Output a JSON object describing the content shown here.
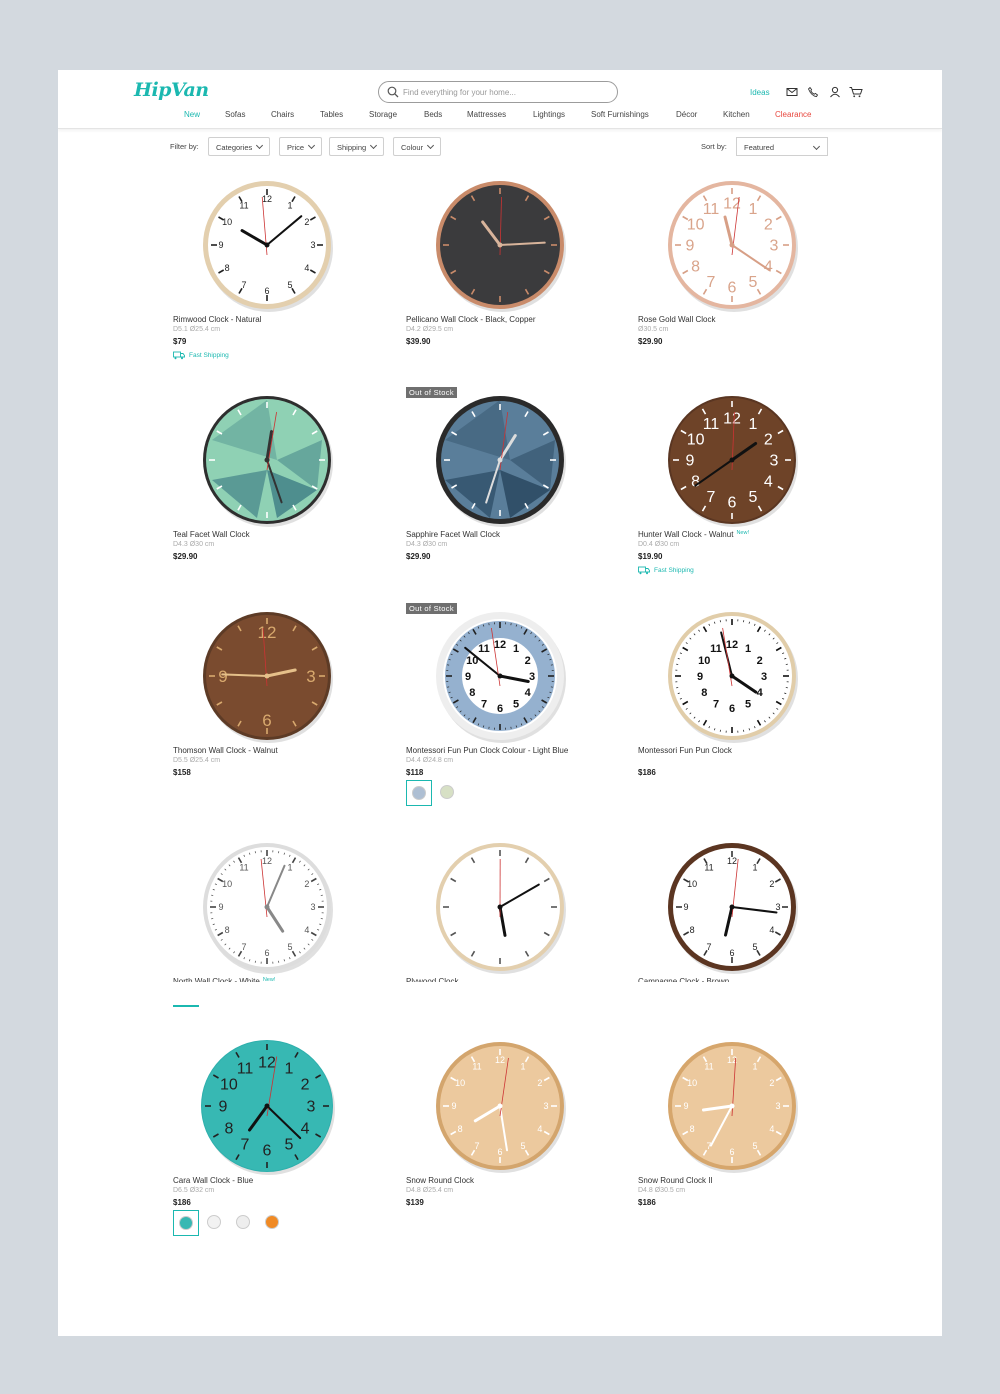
{
  "header": {
    "logo": "HipVan",
    "search_placeholder": "Find everything for your home...",
    "ideas_label": "Ideas",
    "icons": [
      "mail-icon",
      "phone-icon",
      "user-icon",
      "cart-icon"
    ]
  },
  "nav": [
    "New",
    "Sofas",
    "Chairs",
    "Tables",
    "Storage",
    "Beds",
    "Mattresses",
    "Lightings",
    "Soft Furnishings",
    "Décor",
    "Kitchen",
    "Clearance"
  ],
  "colors": {
    "accent": "#1bb8b0",
    "clearance": "#e8483f",
    "oos_badge": "#6f6f6f"
  },
  "filters": {
    "label": "Filter by:",
    "buttons": [
      "Categories",
      "Price",
      "Shipping",
      "Colour"
    ],
    "sort_label": "Sort by:",
    "sort_value": "Featured"
  },
  "products": [
    {
      "name": "Rimwood Clock - Natural",
      "dims": "D5.1 Ø25.4 cm",
      "price": "$79",
      "shipping": "Fast Shipping"
    },
    {
      "name": "Pellicano Wall Clock - Black, Copper",
      "dims": "D4.2 Ø29.5 cm",
      "price": "$39.90"
    },
    {
      "name": "Rose Gold Wall Clock",
      "dims": "Ø30.5 cm",
      "price": "$29.90"
    },
    {
      "name": "Teal Facet Wall Clock",
      "dims": "D4.3 Ø30 cm",
      "price": "$29.90"
    },
    {
      "name": "Sapphire Facet Wall Clock",
      "dims": "D4.3 Ø30 cm",
      "price": "$29.90",
      "badge": "Out of Stock"
    },
    {
      "name": "Hunter Wall Clock - Walnut",
      "dims": "D0.4 Ø30 cm",
      "price": "$19.90",
      "tag": "New!",
      "shipping": "Fast Shipping"
    },
    {
      "name": "Thomson Wall Clock - Walnut",
      "dims": "D5.5 Ø25.4 cm",
      "price": "$158"
    },
    {
      "name": "Montessori Fun Pun Clock Colour - Light Blue",
      "dims": "D4.4 Ø24.8 cm",
      "price": "$118",
      "badge": "Out of Stock"
    },
    {
      "name": "Montessori Fun Pun Clock",
      "dims": "",
      "price": "$186"
    },
    {
      "name": "North Wall Clock - White",
      "dims": "",
      "price": "",
      "tag": "New!"
    },
    {
      "name": "Plywood Clock",
      "dims": "",
      "price": ""
    },
    {
      "name": "Campagne Clock - Brown",
      "dims": "",
      "price": ""
    },
    {
      "name": "Cara Wall Clock - Blue",
      "dims": "D6.5 Ø32 cm",
      "price": "$186"
    },
    {
      "name": "Snow Round Clock",
      "dims": "D4.8 Ø25.4 cm",
      "price": "$139"
    },
    {
      "name": "Snow Round Clock II",
      "dims": "D4.8 Ø30.5 cm",
      "price": "$186"
    }
  ]
}
